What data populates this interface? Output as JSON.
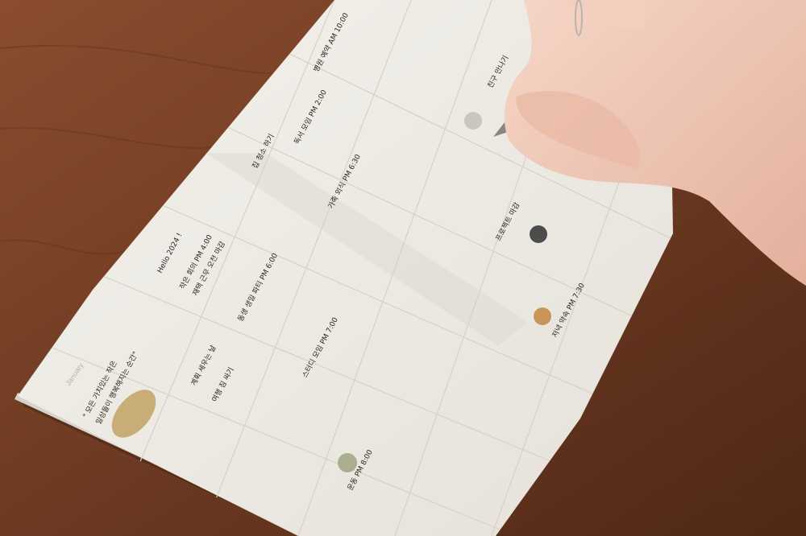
{
  "scene": {
    "description_tag": "photo",
    "colors": {
      "table_dark": "#5a2f1b",
      "table_mid": "#7a4428",
      "table_light": "#8e5232",
      "paper": "#efece6",
      "paper_shadow": "#dcd6cc",
      "grid_line": "#d9d4cb",
      "ink": "#2a2622",
      "skin": "#f1cbbb",
      "skin_shadow": "#d9a693",
      "pen_body": "#1c1b1b",
      "pen_grip": "#6a5a4c",
      "sticker_gold": "#c8ad77",
      "sticker_gray": "#c9c6c0",
      "sticker_dark": "#4a4d4b",
      "sticker_orange": "#c9955a",
      "sticker_sage": "#a9ae8c",
      "card": "#e8ddd2"
    }
  },
  "planner": {
    "month_label": "January",
    "notes": [
      "\" 모든 가치있는 작은",
      "일상들이 행복해지는 순간\"",
      "Hello 2024 !",
      "작은 회의 PM 4:00",
      "재택 근무 오전 마감",
      "동생 생일 파티 PM 6:00",
      "스터디 모임 PM 7:00",
      "계획 세우는 날",
      "여행 짐 싸기",
      "독서 모임 PM 2:00",
      "집 청소 하기",
      "가족 외식 PM 6:30",
      "병원 예약 AM 10:00",
      "프로젝트 마감",
      "저녁 약속 PM 7:30",
      "운동 PM 8:00",
      "친구 만나기"
    ],
    "stickers": [
      "gold-oval",
      "gray-dot",
      "dark-dot",
      "orange-dot",
      "sage-dot"
    ]
  }
}
